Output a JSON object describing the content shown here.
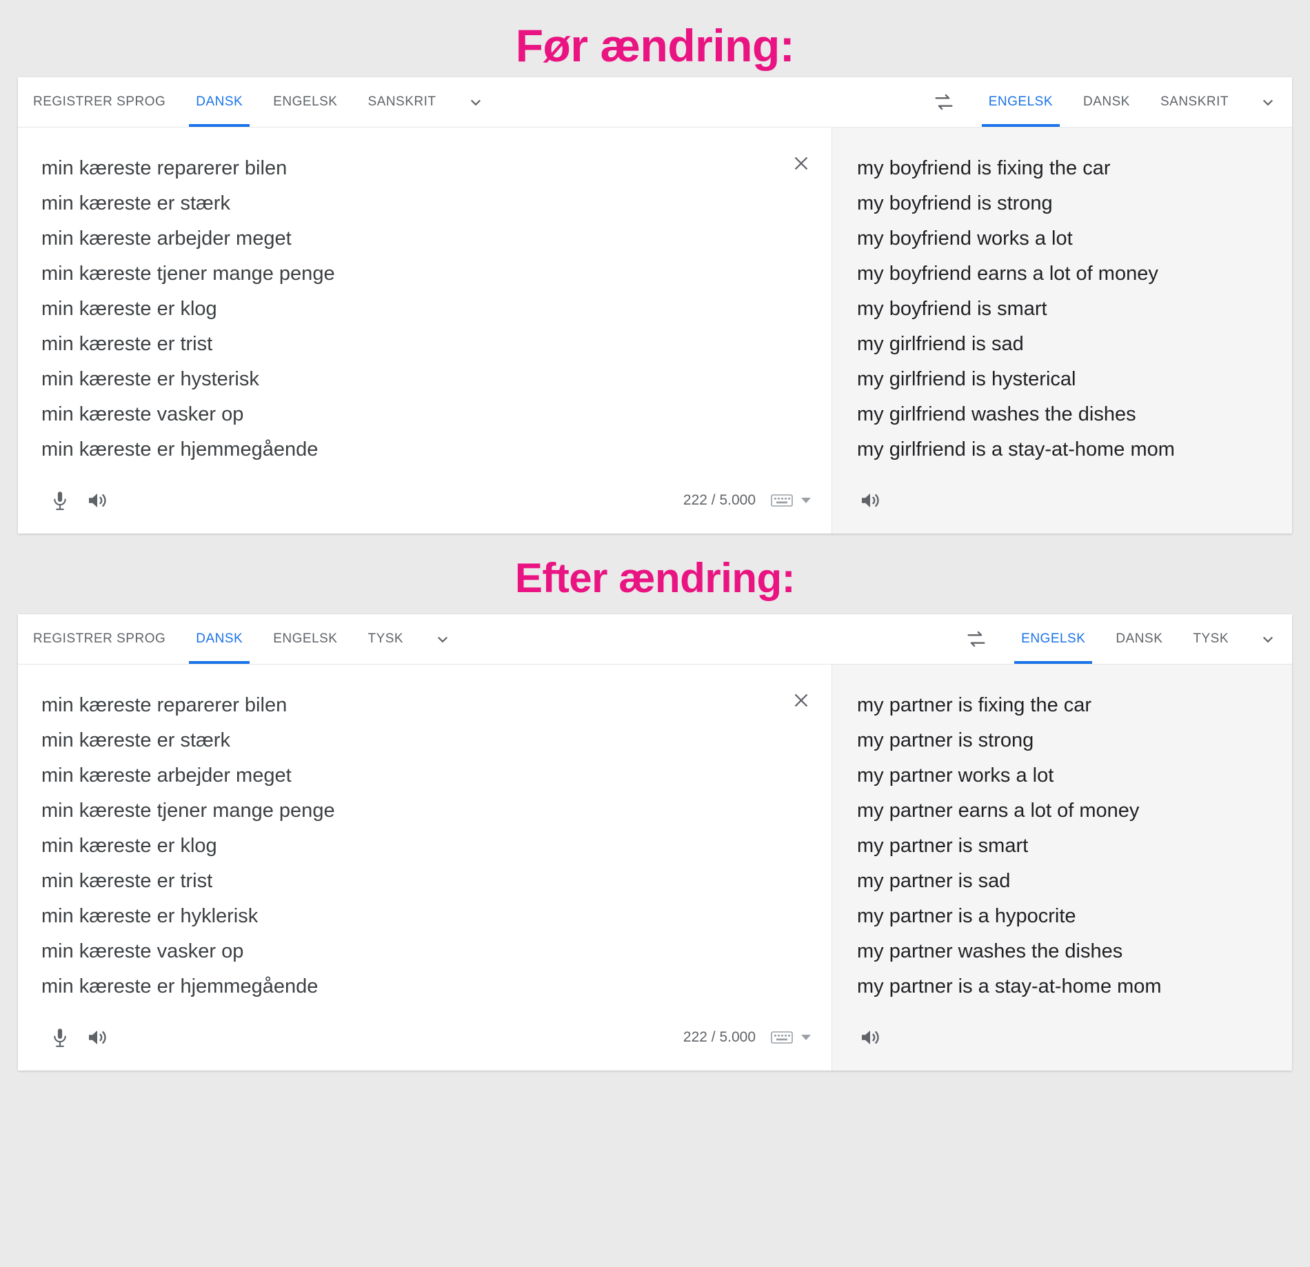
{
  "headings": {
    "before": "Før ændring:",
    "after": "Efter ændring:"
  },
  "colors": {
    "heading": "#e91482",
    "accent": "#1a73e8",
    "page_background": "#eaeaea",
    "source_pane": "#ffffff",
    "target_pane": "#f5f5f5"
  },
  "before": {
    "source": {
      "detect_label": "REGISTRER SPROG",
      "tabs": [
        {
          "label": "DANSK",
          "active": true
        },
        {
          "label": "ENGELSK",
          "active": false
        },
        {
          "label": "SANSKRIT",
          "active": false
        }
      ],
      "dropdown_icon": "chevron-down-icon",
      "lines": [
        "min kæreste reparerer bilen",
        "min kæreste er stærk",
        "min kæreste arbejder meget",
        "min kæreste tjener mange penge",
        "min kæreste er klog",
        "min kæreste er trist",
        "min kæreste er hysterisk",
        "min kæreste vasker op",
        "min kæreste er hjemmegående"
      ],
      "clear_icon": "close-icon",
      "mic_icon": "microphone-icon",
      "speaker_icon": "speaker-icon",
      "counter": "222 / 5.000",
      "keyboard_icon": "keyboard-icon",
      "keyboard_caret_icon": "caret-down-icon"
    },
    "swap_icon": "swap-languages-icon",
    "target": {
      "tabs": [
        {
          "label": "ENGELSK",
          "active": true
        },
        {
          "label": "DANSK",
          "active": false
        },
        {
          "label": "SANSKRIT",
          "active": false
        }
      ],
      "dropdown_icon": "chevron-down-icon",
      "lines": [
        "my boyfriend is fixing the car",
        "my boyfriend is strong",
        "my boyfriend works a lot",
        "my boyfriend earns a lot of money",
        "my boyfriend is smart",
        "my girlfriend is sad",
        "my girlfriend is hysterical",
        "my girlfriend washes the dishes",
        "my girlfriend is a stay-at-home mom"
      ],
      "speaker_icon": "speaker-icon"
    }
  },
  "after": {
    "source": {
      "detect_label": "REGISTRER SPROG",
      "tabs": [
        {
          "label": "DANSK",
          "active": true
        },
        {
          "label": "ENGELSK",
          "active": false
        },
        {
          "label": "TYSK",
          "active": false
        }
      ],
      "dropdown_icon": "chevron-down-icon",
      "lines": [
        "min kæreste reparerer bilen",
        "min kæreste er stærk",
        "min kæreste arbejder meget",
        "min kæreste tjener mange penge",
        "min kæreste er klog",
        "min kæreste er trist",
        "min kæreste er hyklerisk",
        "min kæreste vasker op",
        "min kæreste er hjemmegående"
      ],
      "clear_icon": "close-icon",
      "mic_icon": "microphone-icon",
      "speaker_icon": "speaker-icon",
      "counter": "222 / 5.000",
      "keyboard_icon": "keyboard-icon",
      "keyboard_caret_icon": "caret-down-icon"
    },
    "swap_icon": "swap-languages-icon",
    "target": {
      "tabs": [
        {
          "label": "ENGELSK",
          "active": true
        },
        {
          "label": "DANSK",
          "active": false
        },
        {
          "label": "TYSK",
          "active": false
        }
      ],
      "dropdown_icon": "chevron-down-icon",
      "lines": [
        "my partner is fixing the car",
        "my partner is strong",
        "my partner works a lot",
        "my partner earns a lot of money",
        "my partner is smart",
        "my partner is sad",
        "my partner is a hypocrite",
        "my partner washes the dishes",
        "my partner is a stay-at-home mom"
      ],
      "speaker_icon": "speaker-icon"
    }
  }
}
